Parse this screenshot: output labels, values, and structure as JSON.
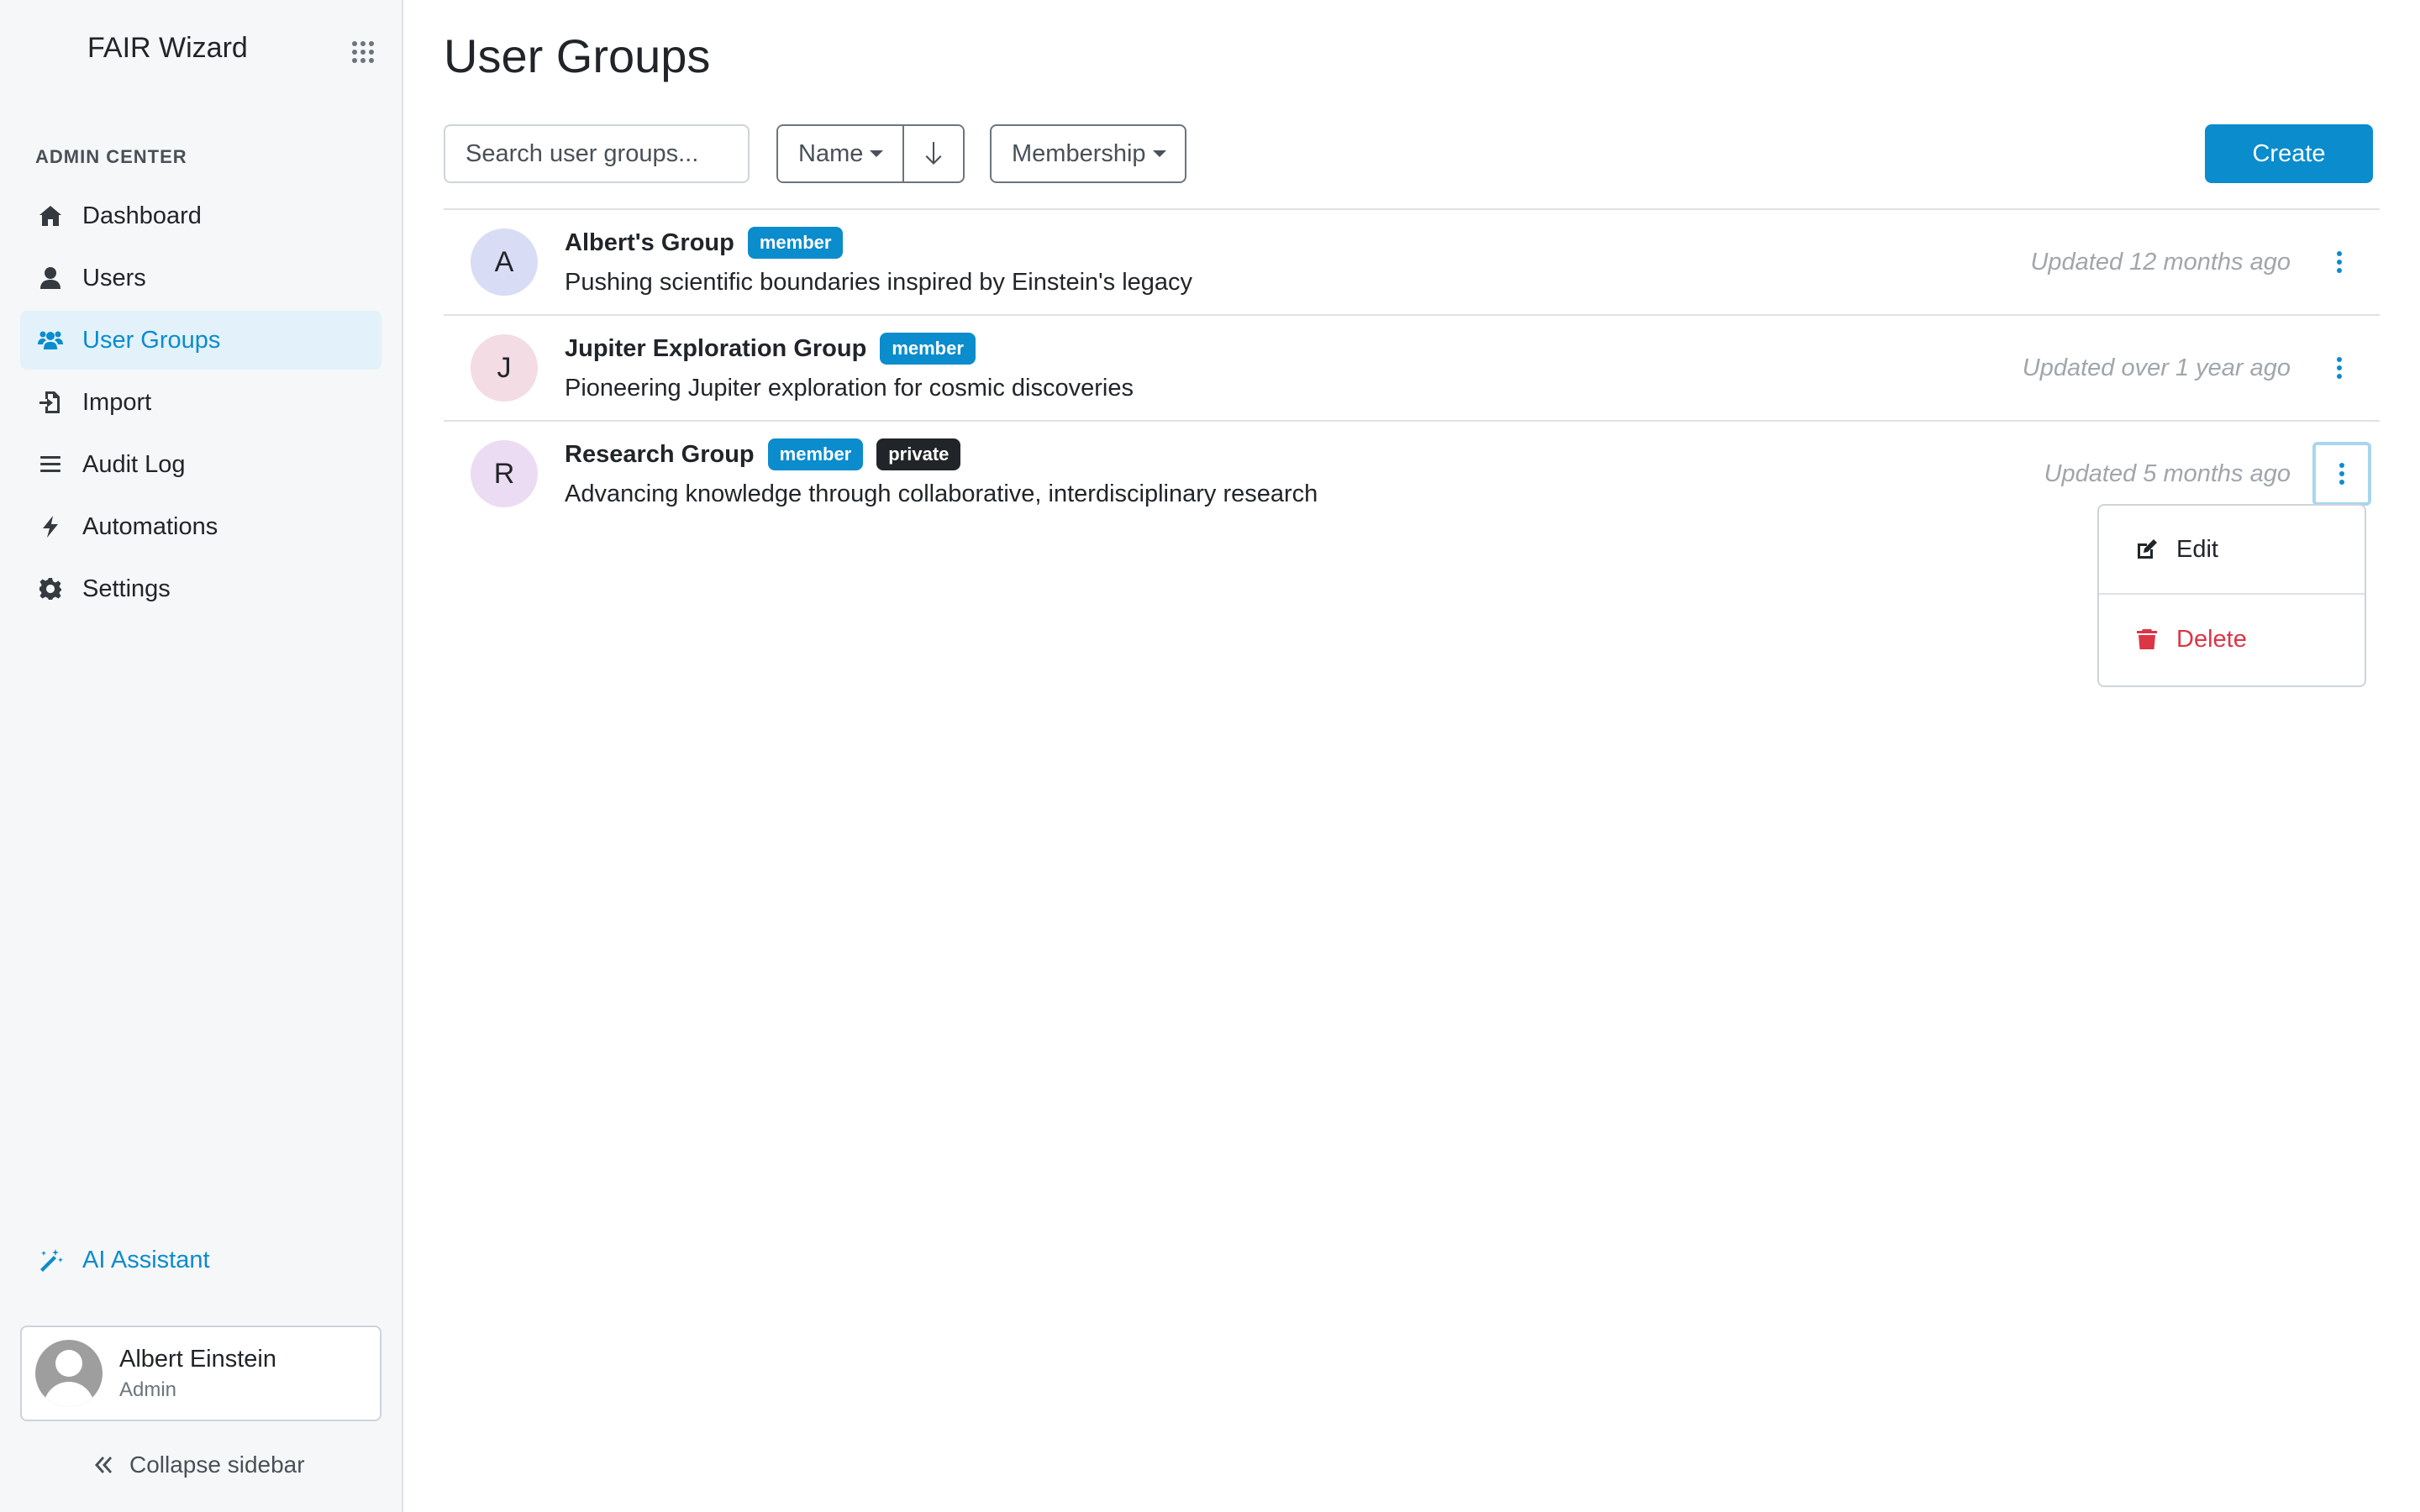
{
  "sidebar": {
    "brand": "FAIR Wizard",
    "section_label": "ADMIN CENTER",
    "items": [
      {
        "label": "Dashboard",
        "icon": "home-icon"
      },
      {
        "label": "Users",
        "icon": "user-icon"
      },
      {
        "label": "User Groups",
        "icon": "users-icon",
        "active": true
      },
      {
        "label": "Import",
        "icon": "file-import-icon"
      },
      {
        "label": "Audit Log",
        "icon": "list-icon"
      },
      {
        "label": "Automations",
        "icon": "bolt-icon"
      },
      {
        "label": "Settings",
        "icon": "gear-icon"
      }
    ],
    "ai_assistant": "AI Assistant",
    "profile": {
      "name": "Albert Einstein",
      "role": "Admin"
    },
    "collapse": "Collapse sidebar"
  },
  "main": {
    "title": "User Groups",
    "search_placeholder": "Search user groups...",
    "sort_label": "Name",
    "membership_label": "Membership",
    "create_label": "Create",
    "groups": [
      {
        "initial": "A",
        "name": "Albert's Group",
        "badges": [
          "member"
        ],
        "description": "Pushing scientific boundaries inspired by Einstein's legacy",
        "updated": "Updated 12 months ago",
        "avatar_color": "#d9dcf5"
      },
      {
        "initial": "J",
        "name": "Jupiter Exploration Group",
        "badges": [
          "member"
        ],
        "description": "Pioneering Jupiter exploration for cosmic discoveries",
        "updated": "Updated over 1 year ago",
        "avatar_color": "#f3dce3"
      },
      {
        "initial": "R",
        "name": "Research Group",
        "badges": [
          "member",
          "private"
        ],
        "description": "Advancing knowledge through collaborative, interdisciplinary research",
        "updated": "Updated 5 months ago",
        "avatar_color": "#ecdcf3"
      }
    ],
    "dropdown": {
      "edit": "Edit",
      "delete": "Delete"
    }
  },
  "colors": {
    "accent": "#0b8ccd",
    "danger": "#dc3545",
    "dark_badge": "#212529"
  }
}
